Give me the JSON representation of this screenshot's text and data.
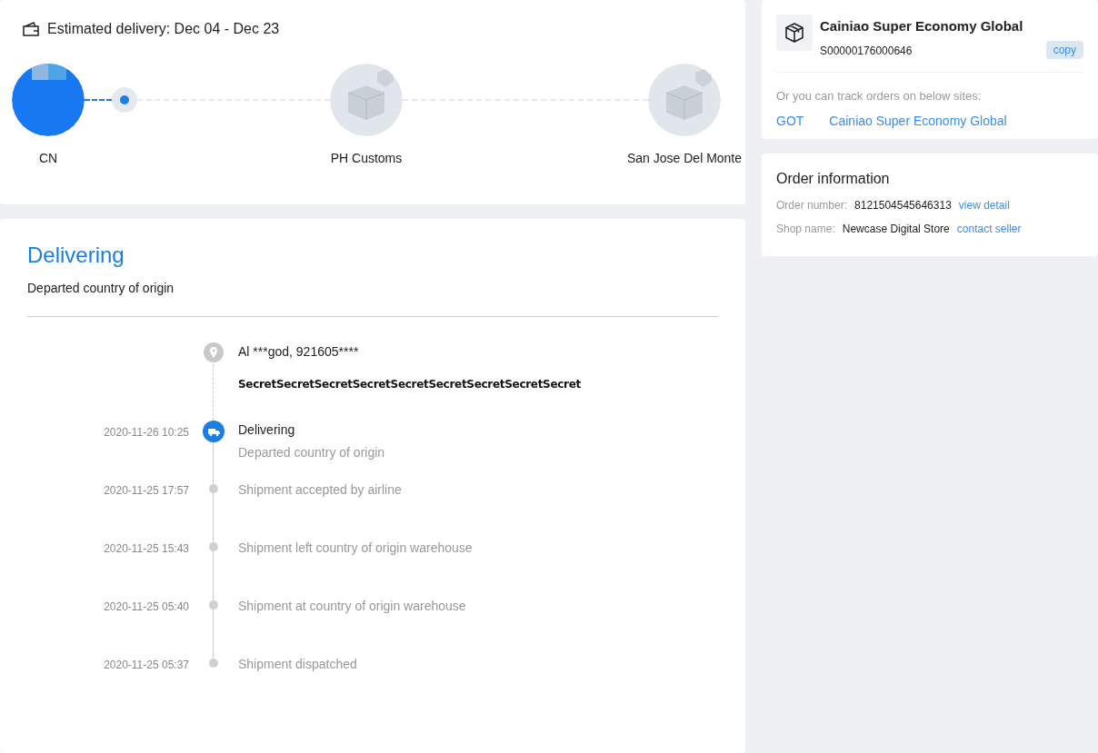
{
  "delivery": {
    "estimate": "Estimated delivery: Dec 04 - Dec 23"
  },
  "stages": [
    {
      "label": "CN",
      "reached": true
    },
    {
      "label": "PH Customs",
      "reached": false
    },
    {
      "label": "San Jose Del Monte",
      "reached": false
    }
  ],
  "status": {
    "title": "Delivering",
    "subtitle": "Departed country of origin"
  },
  "address": {
    "name_line": "Al ***god,  921605****",
    "redaction": "SecretSecretSecretSecretSecretSecretSecretSecretSecret"
  },
  "events": [
    {
      "time": "2020-11-26 10:25",
      "title": "Delivering",
      "detail": "Departed country of origin",
      "current": true
    },
    {
      "time": "2020-11-25 17:57",
      "title": "Shipment accepted by airline",
      "current": false
    },
    {
      "time": "2020-11-25 15:43",
      "title": "Shipment left country of origin warehouse",
      "current": false
    },
    {
      "time": "2020-11-25 05:40",
      "title": "Shipment at country of origin warehouse",
      "current": false
    },
    {
      "time": "2020-11-25 05:37",
      "title": "Shipment dispatched",
      "current": false
    }
  ],
  "carrier": {
    "name": "Cainiao Super Economy Global",
    "tracking_number": "S00000176000646",
    "copy_button": "copy",
    "sites_label": "Or you can track orders on below sites:",
    "sites": [
      "GOT",
      "Cainiao Super Economy Global"
    ]
  },
  "order": {
    "title": "Order information",
    "fields": [
      {
        "label": "Order number:",
        "value": "8121504545646313",
        "link": "view detail"
      },
      {
        "label": "Shop name:",
        "value": "Newcase Digital Store",
        "link": "contact seller"
      }
    ]
  }
}
